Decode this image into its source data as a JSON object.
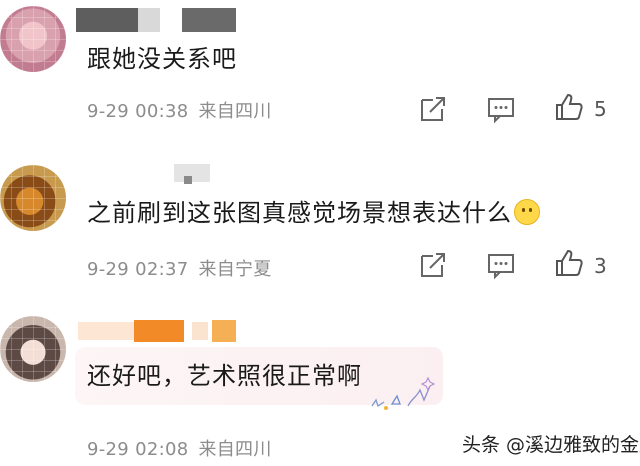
{
  "comments": [
    {
      "text": "跟她没关系吧",
      "date": "9-29 00:38",
      "region": "来自四川",
      "likes": "5",
      "emoji": false
    },
    {
      "text": "之前刷到这张图真感觉场景想表达什么",
      "date": "9-29 02:37",
      "region": "来自宁夏",
      "likes": "3",
      "emoji": true
    },
    {
      "text": "还好吧，艺术照很正常啊",
      "date": "9-29 02:08",
      "region": "来自四川",
      "likes": "",
      "emoji": false
    }
  ],
  "icons": {
    "repost": "share-box-icon",
    "comment": "comment-bubble-icon",
    "like": "thumbs-up-icon"
  },
  "watermark": "头条 @溪边雅致的金鳌",
  "colors": {
    "meta_gray": "#8c8c8c",
    "name_blur_1": "#9a9a9a",
    "name_blur_orange": "#f28a28"
  }
}
